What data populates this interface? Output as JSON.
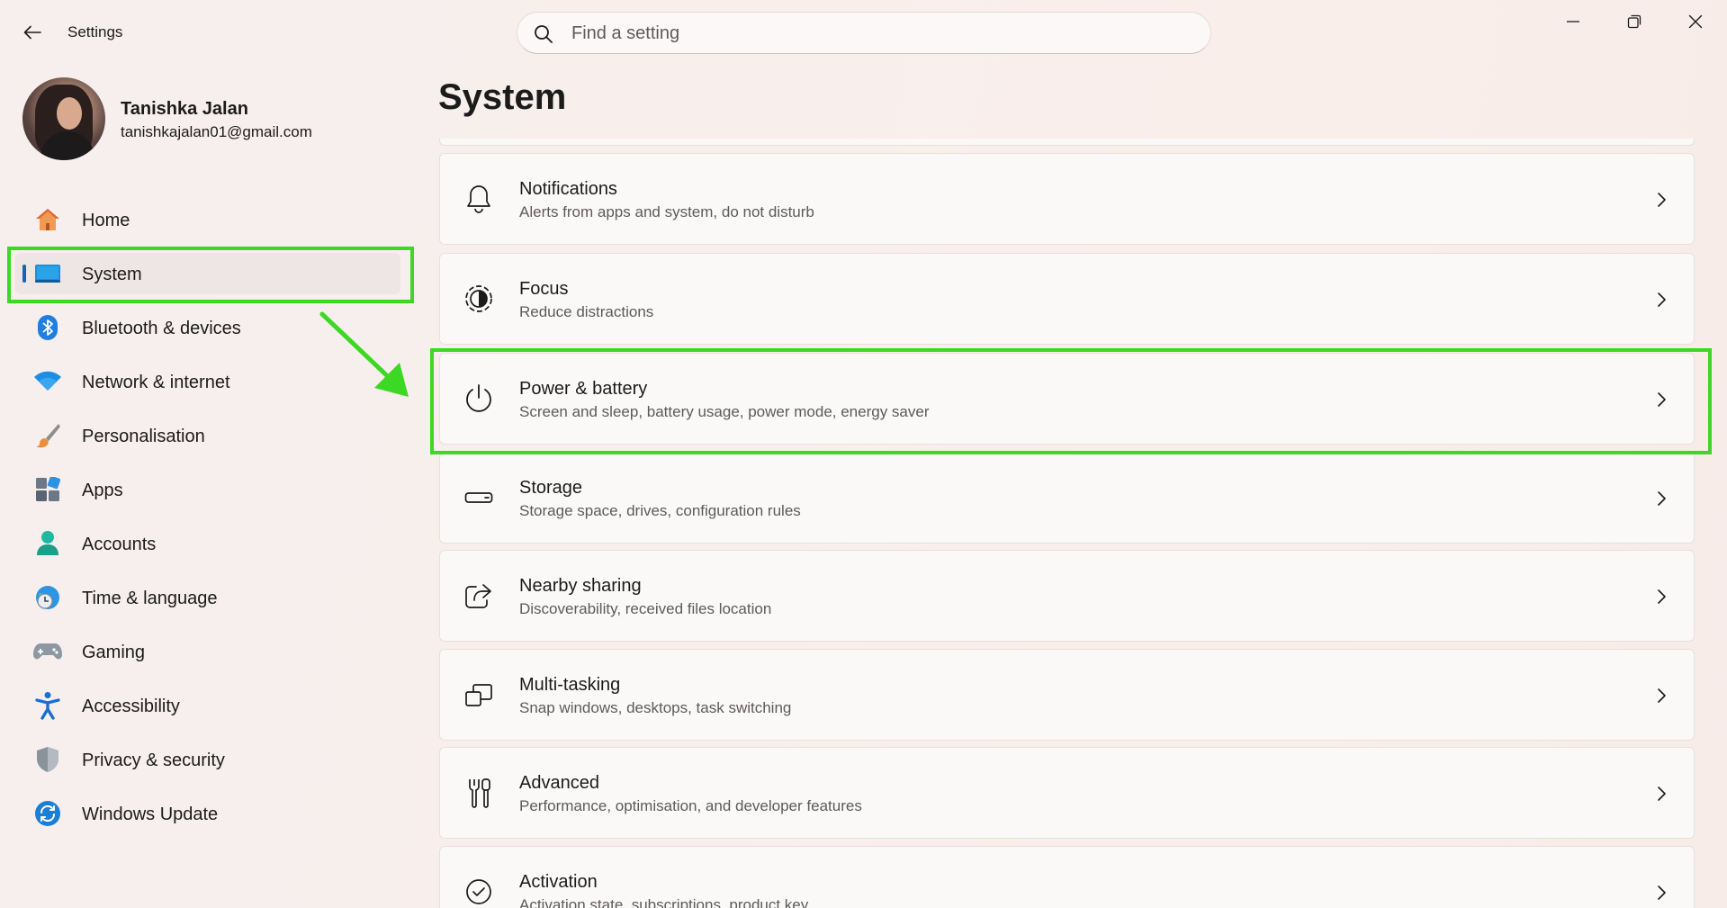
{
  "window": {
    "title": "Settings",
    "controls": [
      "minimize-icon",
      "restore-icon",
      "close-icon"
    ]
  },
  "search": {
    "placeholder": "Find a setting",
    "value": ""
  },
  "profile": {
    "name": "Tanishka Jalan",
    "email": "tanishkajalan01@gmail.com"
  },
  "sidebar": {
    "items": [
      {
        "label": "Home",
        "icon": "home-icon"
      },
      {
        "label": "System",
        "icon": "system-monitor-icon",
        "active": true
      },
      {
        "label": "Bluetooth & devices",
        "icon": "bluetooth-icon"
      },
      {
        "label": "Network & internet",
        "icon": "wifi-icon"
      },
      {
        "label": "Personalisation",
        "icon": "paintbrush-icon"
      },
      {
        "label": "Apps",
        "icon": "apps-icon"
      },
      {
        "label": "Accounts",
        "icon": "account-icon"
      },
      {
        "label": "Time & language",
        "icon": "globe-clock-icon"
      },
      {
        "label": "Gaming",
        "icon": "gamepad-icon"
      },
      {
        "label": "Accessibility",
        "icon": "accessibility-icon"
      },
      {
        "label": "Privacy & security",
        "icon": "shield-icon"
      },
      {
        "label": "Windows Update",
        "icon": "update-icon"
      }
    ]
  },
  "main": {
    "title": "System",
    "cards": [
      {
        "title": "Notifications",
        "desc": "Alerts from apps and system, do not disturb",
        "icon": "bell-icon"
      },
      {
        "title": "Focus",
        "desc": "Reduce distractions",
        "icon": "focus-icon"
      },
      {
        "title": "Power & battery",
        "desc": "Screen and sleep, battery usage, power mode, energy saver",
        "icon": "power-icon"
      },
      {
        "title": "Storage",
        "desc": "Storage space, drives, configuration rules",
        "icon": "storage-icon"
      },
      {
        "title": "Nearby sharing",
        "desc": "Discoverability, received files location",
        "icon": "share-icon"
      },
      {
        "title": "Multi-tasking",
        "desc": "Snap windows, desktops, task switching",
        "icon": "multitasking-icon"
      },
      {
        "title": "Advanced",
        "desc": "Performance, optimisation, and developer features",
        "icon": "tools-icon"
      },
      {
        "title": "Activation",
        "desc": "Activation state, subscriptions, product key",
        "icon": "checkmark-circle-icon"
      }
    ]
  },
  "annotations": {
    "highlight_color": "#3cd823",
    "highlighted": [
      "System",
      "Power & battery"
    ]
  }
}
